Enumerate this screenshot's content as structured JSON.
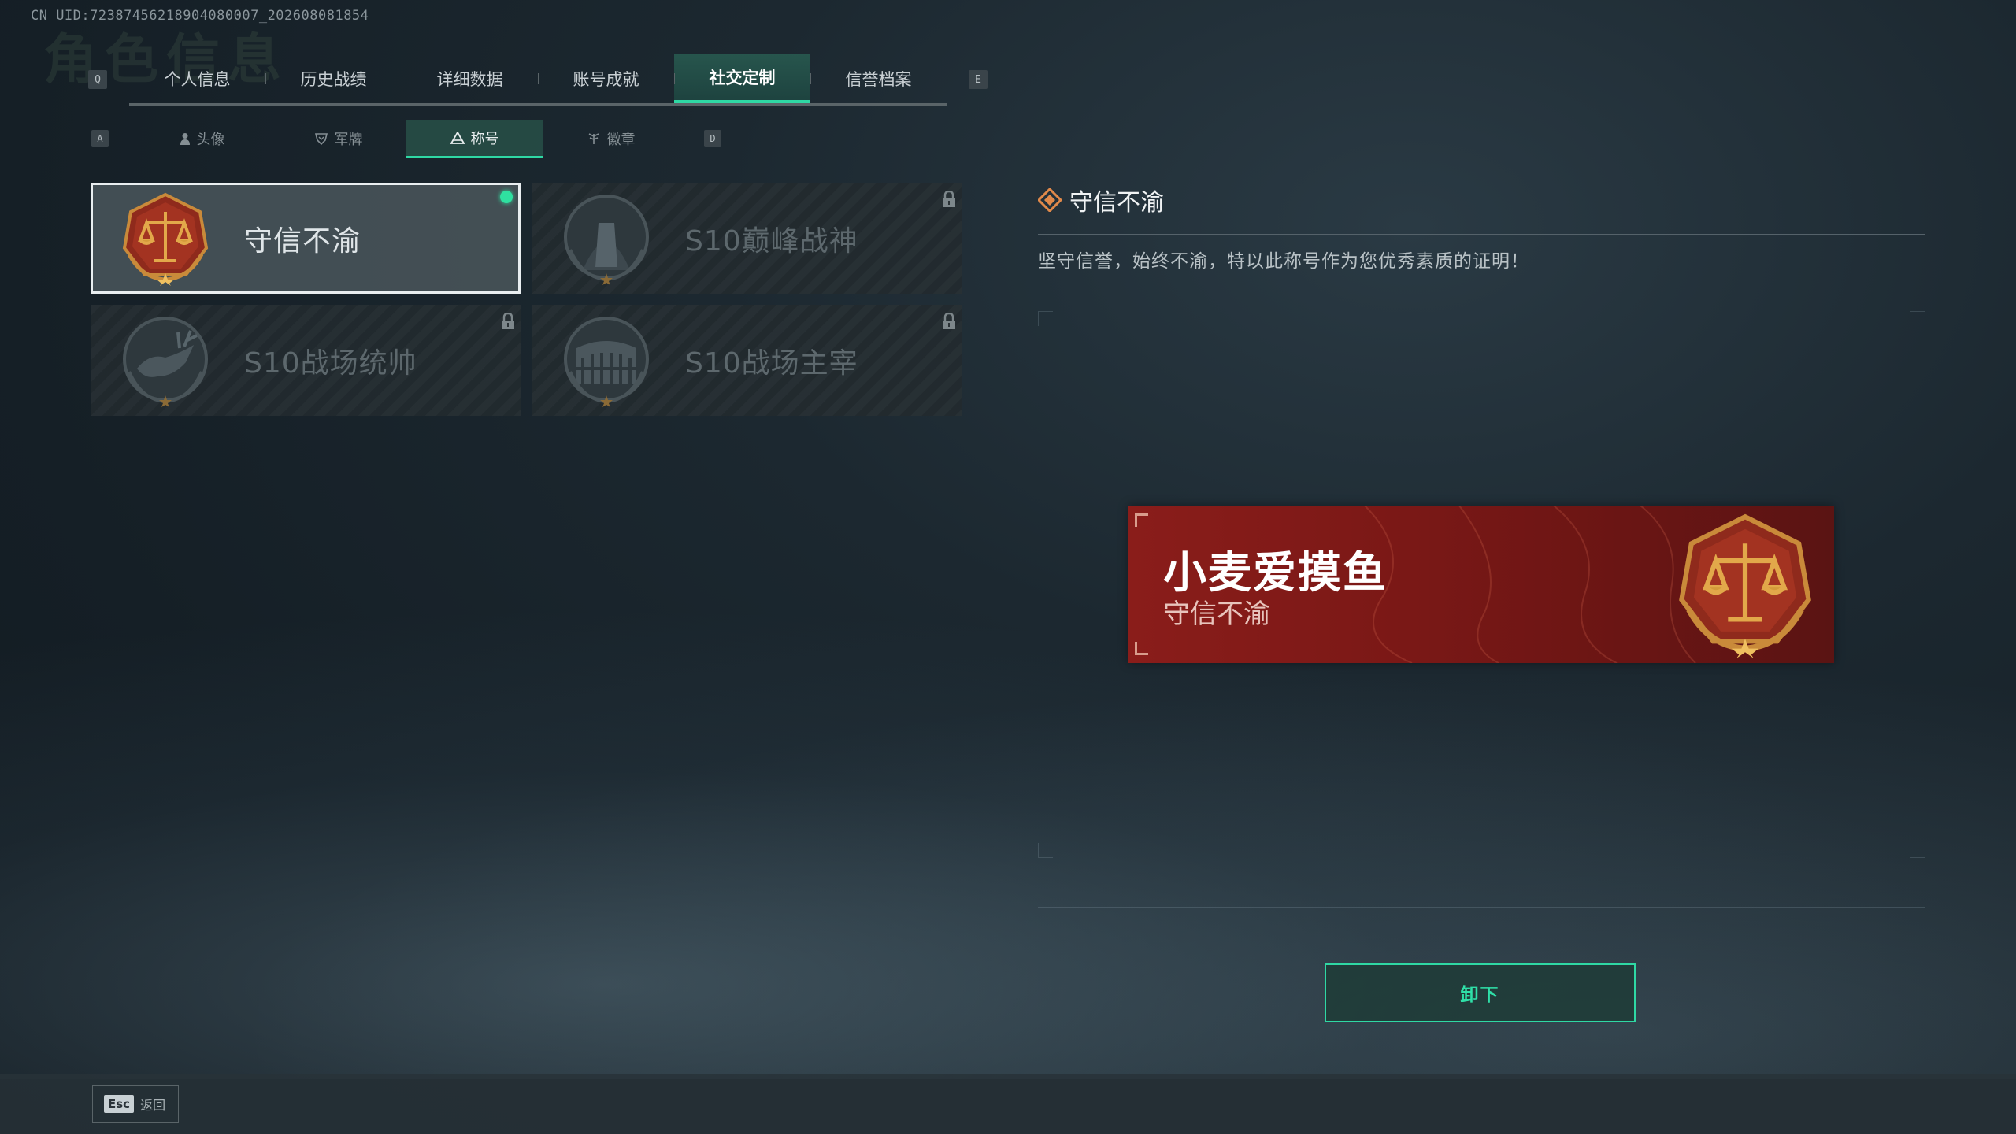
{
  "uid": "CN UID:723874562189040800​07_202608081854",
  "bg_title": "角色信息",
  "tabs": {
    "left_key": "Q",
    "right_key": "E",
    "items": [
      "个人信息",
      "历史战绩",
      "详细数据",
      "账号成就",
      "社交定制",
      "信誉档案"
    ],
    "active": "社交定制"
  },
  "subtabs": {
    "left_key": "A",
    "right_key": "D",
    "items": [
      "头像",
      "军牌",
      "称号",
      "徽章"
    ],
    "active": "称号"
  },
  "titles": [
    {
      "name": "守信不渝",
      "selected": true,
      "equipped": true,
      "locked": false,
      "icon": "scales-emblem-icon"
    },
    {
      "name": "S10巅峰战神",
      "selected": false,
      "equipped": false,
      "locked": true,
      "icon": "monument-emblem-icon"
    },
    {
      "name": "S10战场统帅",
      "selected": false,
      "equipped": false,
      "locked": true,
      "icon": "deer-emblem-icon"
    },
    {
      "name": "S10战场主宰",
      "selected": false,
      "equipped": false,
      "locked": true,
      "icon": "colosseum-emblem-icon"
    }
  ],
  "detail": {
    "title": "守信不渝",
    "description": "坚守信誉，始终不渝，特以此称号作为您优秀素质的证明！"
  },
  "banner": {
    "player_name": "小麦爱摸鱼",
    "title": "守信不渝"
  },
  "action_button": "卸下",
  "back": {
    "key": "Esc",
    "label": "返回"
  },
  "colors": {
    "accent": "#2fd8a4",
    "banner_red": "#8a1d1a",
    "emblem_gold": "#d49a3a"
  }
}
